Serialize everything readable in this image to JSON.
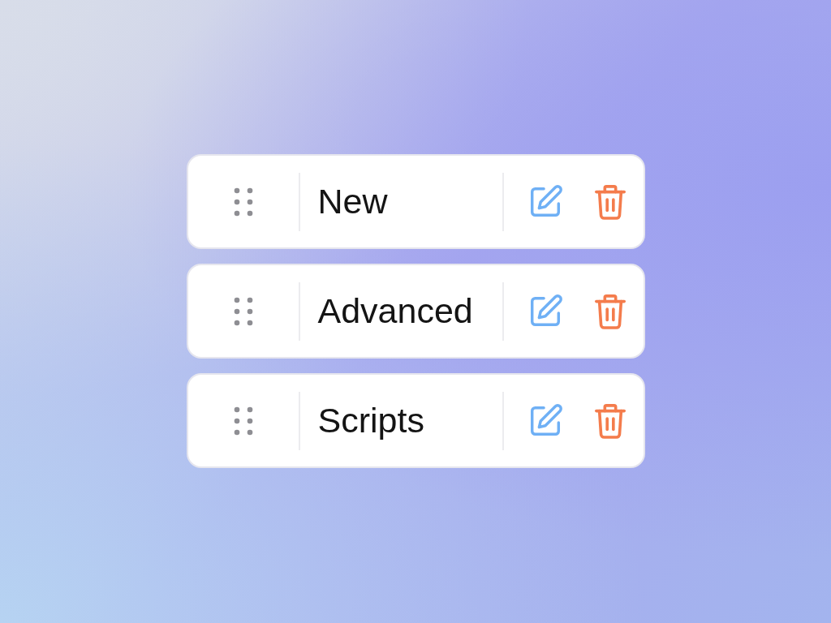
{
  "items": [
    {
      "label": "New"
    },
    {
      "label": "Advanced"
    },
    {
      "label": "Scripts"
    }
  ]
}
